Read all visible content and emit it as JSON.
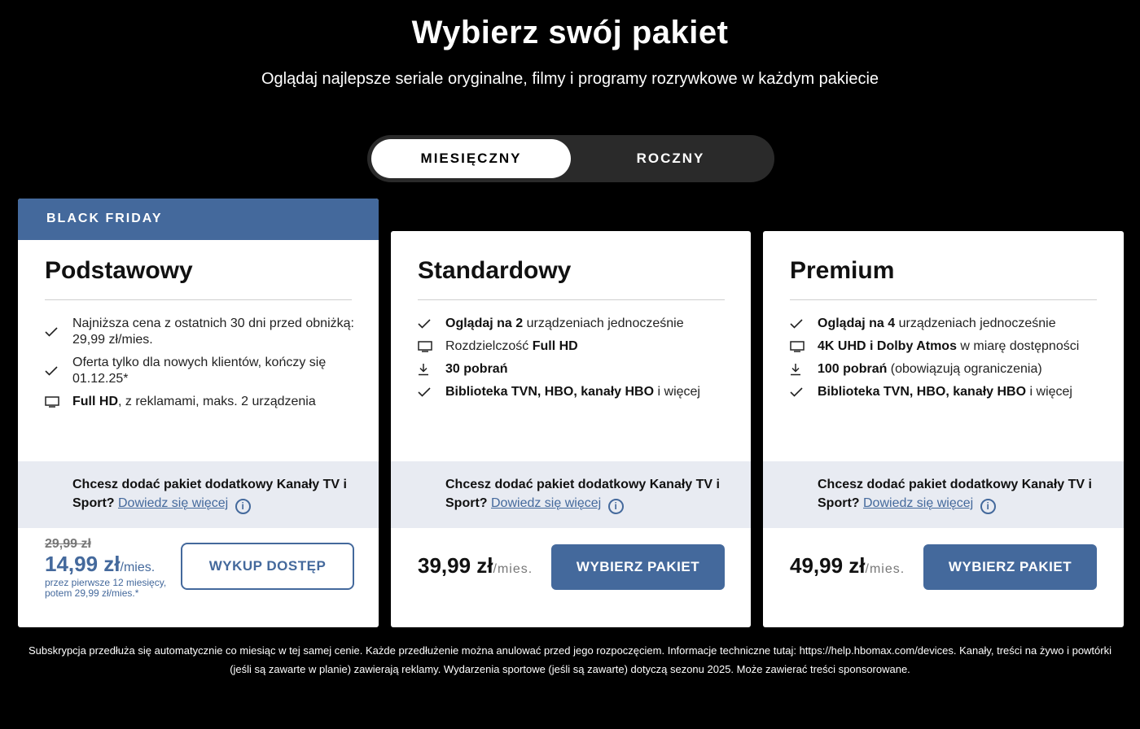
{
  "header": {
    "title": "Wybierz swój pakiet",
    "subtitle": "Oglądaj najlepsze seriale oryginalne, filmy i programy rozrywkowe w każdym pakiecie"
  },
  "billing_toggle": {
    "monthly": "MIESIĘCZNY",
    "yearly": "ROCZNY",
    "selected": "MIESIĘCZNY"
  },
  "plans": [
    {
      "ribbon": "BLACK FRIDAY",
      "name": "Podstawowy",
      "features": [
        {
          "icon": "check-icon",
          "bold": "",
          "text": "Najniższa cena z ostatnich 30 dni przed obniżką: 29,99 zł/mies."
        },
        {
          "icon": "check-icon",
          "bold": "",
          "text": "Oferta tylko dla nowych klientów, kończy się 01.12.25*"
        },
        {
          "icon": "monitor-icon",
          "bold": "Full HD",
          "text": ", z reklamami, maks. 2 urządzenia"
        }
      ],
      "addon": {
        "text": "Chcesz dodać pakiet dodatkowy Kanały TV i Sport?",
        "link": "Dowiedz się więcej"
      },
      "old_price": "29,99 zł",
      "price": "14,99 zł",
      "per": "/mies.",
      "price_note": "przez pierwsze 12 miesięcy, potem 29,99 zł/mies.*",
      "button": "WYKUP DOSTĘP"
    },
    {
      "name": "Standardowy",
      "features": [
        {
          "icon": "check-icon",
          "bold": "Oglądaj na 2",
          "text": " urządzeniach jednocześnie"
        },
        {
          "icon": "monitor-icon",
          "pre": "Rozdzielczość ",
          "bold": "Full HD",
          "text": ""
        },
        {
          "icon": "download-icon",
          "bold": "30 pobrań",
          "text": ""
        },
        {
          "icon": "check-icon",
          "bold": "Biblioteka TVN, HBO, kanały HBO",
          "text": " i więcej"
        }
      ],
      "addon": {
        "text": "Chcesz dodać pakiet dodatkowy Kanały TV i Sport?",
        "link": "Dowiedz się więcej"
      },
      "price": "39,99 zł",
      "per": "/mies.",
      "button": "WYBIERZ PAKIET"
    },
    {
      "name": "Premium",
      "features": [
        {
          "icon": "check-icon",
          "bold": "Oglądaj na 4",
          "text": " urządzeniach jednocześnie"
        },
        {
          "icon": "monitor-icon",
          "bold": "4K UHD i Dolby Atmos",
          "text": " w miarę dostępności"
        },
        {
          "icon": "download-icon",
          "bold": "100 pobrań",
          "text": " (obowiązują ograniczenia)"
        },
        {
          "icon": "check-icon",
          "bold": "Biblioteka TVN, HBO, kanały HBO",
          "text": " i więcej"
        }
      ],
      "addon": {
        "text": "Chcesz dodać pakiet dodatkowy Kanały TV i Sport?",
        "link": "Dowiedz się więcej"
      },
      "price": "49,99 zł",
      "per": "/mies.",
      "button": "WYBIERZ PAKIET"
    }
  ],
  "footer": "Subskrypcja przedłuża się automatycznie co miesiąc w tej samej cenie. Każde przedłużenie można anulować przed jego rozpoczęciem. Informacje techniczne tutaj: https://help.hbomax.com/devices. Kanały, treści na żywo i powtórki (jeśli są zawarte w planie) zawierają reklamy. Wydarzenia sportowe (jeśli są zawarte) dotyczą sezonu 2025. Może zawierać treści sponsorowane.",
  "colors": {
    "accent": "#44699c",
    "background": "#000000",
    "addon_bg": "#e8ebf2"
  }
}
